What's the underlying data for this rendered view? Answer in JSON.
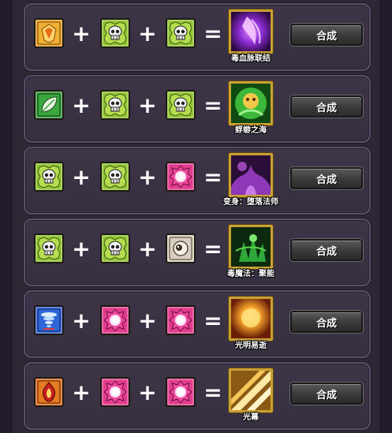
{
  "recipes": [
    {
      "ingredients": [
        {
          "icon": "fire-trinket-icon",
          "color": "#e59a1e"
        },
        {
          "icon": "skull-rune-icon",
          "color": "#8ec431"
        },
        {
          "icon": "skull-rune-icon",
          "color": "#8ec431"
        }
      ],
      "plus": "+",
      "equals": "=",
      "result": {
        "name": "毒血脉联结",
        "icon": "poison-blood-link-icon",
        "color": "#7a2bb8"
      },
      "button": "合成"
    },
    {
      "ingredients": [
        {
          "icon": "leaf-rune-icon",
          "color": "#2f9a3a"
        },
        {
          "icon": "skull-rune-icon",
          "color": "#8ec431"
        },
        {
          "icon": "skull-rune-icon",
          "color": "#8ec431"
        }
      ],
      "plus": "+",
      "equals": "=",
      "result": {
        "name": "蜉蝣之海",
        "icon": "mayfly-sea-icon",
        "color": "#2e9a2e"
      },
      "button": "合成"
    },
    {
      "ingredients": [
        {
          "icon": "skull-rune-icon",
          "color": "#8ec431"
        },
        {
          "icon": "skull-rune-icon",
          "color": "#8ec431"
        },
        {
          "icon": "light-orb-rune-icon",
          "color": "#e23c8e"
        }
      ],
      "plus": "+",
      "equals": "=",
      "result": {
        "name": "变身：堕落法师",
        "icon": "fallen-mage-icon",
        "color": "#6b2a8e"
      },
      "button": "合成"
    },
    {
      "ingredients": [
        {
          "icon": "skull-rune-icon",
          "color": "#8ec431"
        },
        {
          "icon": "skull-rune-icon",
          "color": "#8ec431"
        },
        {
          "icon": "eye-rune-icon",
          "color": "#d9cdb8"
        }
      ],
      "plus": "+",
      "equals": "=",
      "result": {
        "name": "毒魔法：聚能",
        "icon": "poison-magic-focus-icon",
        "color": "#1f7a2a"
      },
      "button": "合成"
    },
    {
      "ingredients": [
        {
          "icon": "tornado-rune-icon",
          "color": "#2f5fd0"
        },
        {
          "icon": "light-orb-rune-icon",
          "color": "#e23c8e"
        },
        {
          "icon": "light-orb-rune-icon",
          "color": "#e23c8e"
        }
      ],
      "plus": "+",
      "equals": "=",
      "result": {
        "name": "光明易逝",
        "icon": "fleeting-light-icon",
        "color": "#e0801e"
      },
      "button": "合成"
    },
    {
      "ingredients": [
        {
          "icon": "flame-crest-rune-icon",
          "color": "#d9661e"
        },
        {
          "icon": "light-orb-rune-icon",
          "color": "#e23c8e"
        },
        {
          "icon": "light-orb-rune-icon",
          "color": "#e23c8e"
        }
      ],
      "plus": "+",
      "equals": "=",
      "result": {
        "name": "光幕",
        "icon": "light-curtain-icon",
        "color": "#e3b24a"
      },
      "button": "合成"
    }
  ]
}
